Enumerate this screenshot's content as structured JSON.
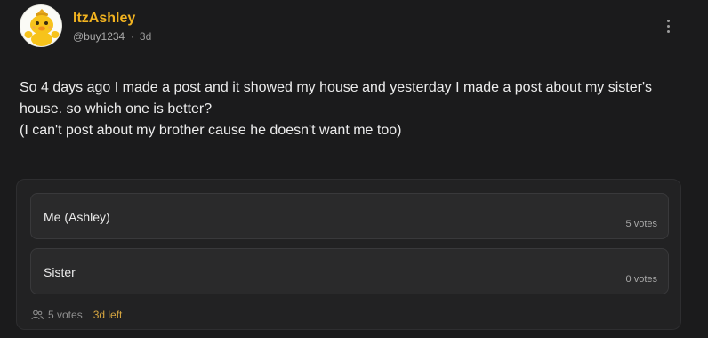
{
  "post": {
    "author": {
      "name": "ItzAshley",
      "handle": "@buy1234",
      "age": "3d"
    },
    "separator": "·",
    "text": [
      "So 4 days ago I made a post and it showed my house and yesterday I made a post about my sister's house. so which one is better?",
      "(I can't post about my brother cause he doesn't want me too)"
    ]
  },
  "poll": {
    "options": [
      {
        "label": "Me (Ashley)",
        "votes": "5 votes"
      },
      {
        "label": "Sister",
        "votes": "0 votes"
      }
    ],
    "total_votes": "5 votes",
    "time_left": "3d left"
  },
  "icons": {
    "menu": "more-vertical-icon",
    "voters": "people-icon",
    "avatar": "cartoon-duck-avatar"
  },
  "colors": {
    "accent": "#f2b320",
    "time_left": "#d6a640",
    "background": "#1b1b1c",
    "card": "#222223",
    "option": "#2a2a2b"
  }
}
